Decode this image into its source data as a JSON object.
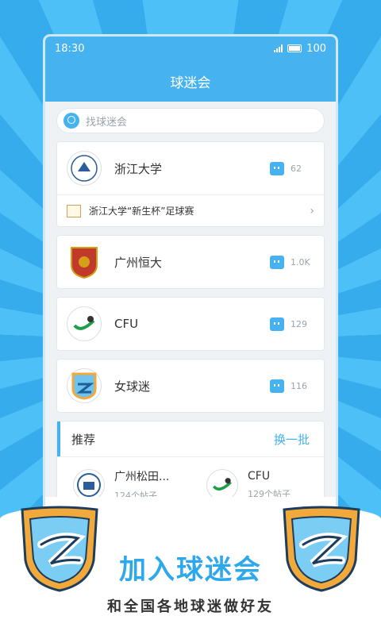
{
  "status": {
    "time": "18:30",
    "battery": "100"
  },
  "header": {
    "title": "球迷会"
  },
  "search": {
    "placeholder": "找球迷会"
  },
  "clubs": [
    {
      "name": "浙江大学",
      "count": "62",
      "sub": "浙江大学“新生杯”足球赛"
    },
    {
      "name": "广州恒大",
      "count": "1.0K"
    },
    {
      "name": "CFU",
      "count": "129"
    },
    {
      "name": "女球迷",
      "count": "116"
    }
  ],
  "recommend": {
    "title": "推荐",
    "swap": "换一批",
    "items": [
      {
        "name": "广州松田...",
        "posts": "124个帖子"
      },
      {
        "name": "CFU",
        "posts": "129个帖子"
      }
    ]
  },
  "promo": {
    "headline": "加入球迷会",
    "tagline": "和全国各地球迷做好友"
  },
  "colors": {
    "accent": "#46b2f0",
    "brand_text": "#2ea8ec"
  }
}
